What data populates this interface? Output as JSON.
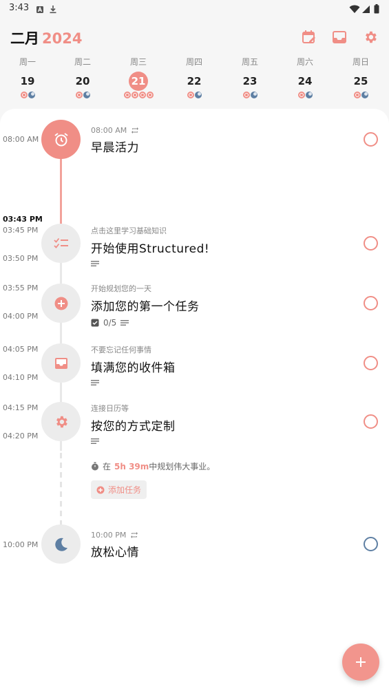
{
  "status_bar": {
    "time": "3:43"
  },
  "header": {
    "month": "二月",
    "year": "2024"
  },
  "week": [
    {
      "weekday": "周一",
      "date": "19",
      "selected": false
    },
    {
      "weekday": "周二",
      "date": "20",
      "selected": false
    },
    {
      "weekday": "周三",
      "date": "21",
      "selected": true
    },
    {
      "weekday": "周四",
      "date": "22",
      "selected": false
    },
    {
      "weekday": "周五",
      "date": "23",
      "selected": false
    },
    {
      "weekday": "周六",
      "date": "24",
      "selected": false
    },
    {
      "weekday": "周日",
      "date": "25",
      "selected": false
    }
  ],
  "now_time": "03:43 PM",
  "tasks": [
    {
      "start": "08:00 AM",
      "sub": "08:00 AM",
      "title": "早晨活力",
      "icon": "alarm-clock-icon",
      "repeat": true
    },
    {
      "start": "03:45 PM",
      "end": "03:50 PM",
      "sub": "点击这里学习基础知识",
      "title": "开始使用Structured!",
      "icon": "checklist-icon"
    },
    {
      "start": "03:55 PM",
      "end": "04:00 PM",
      "sub": "开始规划您的一天",
      "title": "添加您的第一个任务",
      "icon": "plus-circle-icon",
      "subtasks": "0/5"
    },
    {
      "start": "04:05 PM",
      "end": "04:10 PM",
      "sub": "不要忘记任何事情",
      "title": "填满您的收件箱",
      "icon": "inbox-icon"
    },
    {
      "start": "04:15 PM",
      "end": "04:20 PM",
      "sub": "连接日历等",
      "title": "按您的方式定制",
      "icon": "gear-icon"
    },
    {
      "start": "10:00 PM",
      "sub": "10:00 PM",
      "title": "放松心情",
      "icon": "moon-icon",
      "repeat": true
    }
  ],
  "plan": {
    "prefix": "在",
    "duration": "5h 39m",
    "suffix": "中规划伟大事业。"
  },
  "add_task_label": "添加任务",
  "colors": {
    "accent": "#f08e86",
    "night": "#5e7fa3"
  }
}
